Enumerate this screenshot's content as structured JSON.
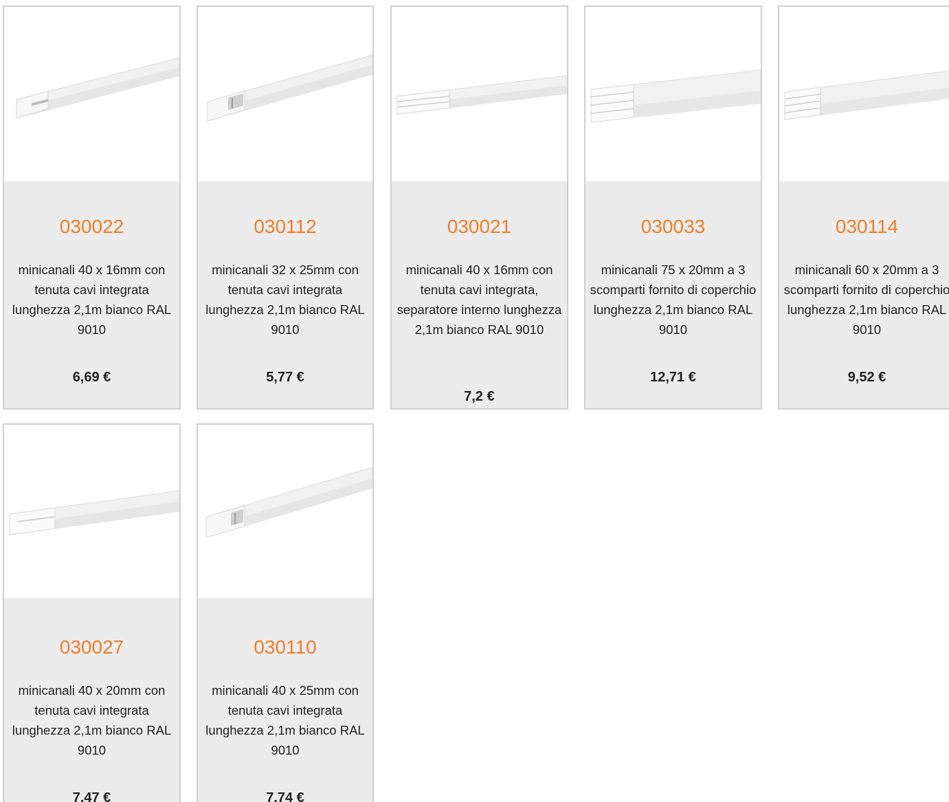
{
  "products": [
    {
      "code": "030022",
      "description": "minicanali 40 x 16mm con tenuta cavi integrata lunghezza 2,1m bianco RAL 9010",
      "price": "6,69 €",
      "image_icon": "cable-trunking-1-compartment-image"
    },
    {
      "code": "030112",
      "description": "minicanali 32 x 25mm con tenuta cavi integrata lunghezza 2,1m bianco RAL 9010",
      "price": "5,77 €",
      "image_icon": "cable-trunking-1-compartment-image"
    },
    {
      "code": "030021",
      "description": "minicanali 40 x 16mm con tenuta cavi integrata, separatore interno lunghezza 2,1m bianco RAL 9010",
      "price": "7,2 €",
      "image_icon": "cable-trunking-2-compartment-image"
    },
    {
      "code": "030033",
      "description": "minicanali 75 x 20mm a 3 scomparti fornito di coperchio lunghezza 2,1m bianco RAL 9010",
      "price": "12,71 €",
      "image_icon": "cable-trunking-3-compartment-image"
    },
    {
      "code": "030114",
      "description": "minicanali 60 x 20mm a 3 scomparti fornito di coperchio lunghezza 2,1m bianco RAL 9010",
      "price": "9,52 €",
      "image_icon": "cable-trunking-3-compartment-image"
    },
    {
      "code": "030027",
      "description": "minicanali 40 x 20mm con tenuta cavi integrata lunghezza 2,1m bianco RAL 9010",
      "price": "7,47 €",
      "image_icon": "cable-trunking-1-compartment-image"
    },
    {
      "code": "030110",
      "description": "minicanali 40 x 25mm con tenuta cavi integrata lunghezza 2,1m bianco RAL 9010",
      "price": "7,74 €",
      "image_icon": "cable-trunking-1-compartment-image"
    }
  ],
  "colors": {
    "code_accent": "#f07d28",
    "card_background": "#ececec",
    "card_border": "#cfcfcf"
  }
}
